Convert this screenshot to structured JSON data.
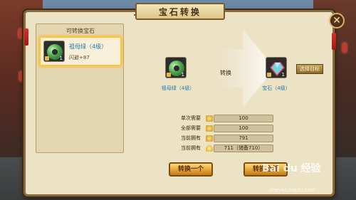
{
  "window": {
    "title": "宝石转换",
    "close_glyph": "✕"
  },
  "left_panel": {
    "header": "可转换宝石",
    "gem": {
      "name": "祖母绿（4级）",
      "stat": "闪避+87",
      "count": "1",
      "icon": "emerald-ring-icon"
    }
  },
  "conversion": {
    "source": {
      "name": "祖母绿（4级）",
      "count": "1",
      "icon": "emerald-ring-icon"
    },
    "target": {
      "name": "宝石（4级）",
      "count": "1",
      "icon": "gem-placeholder-icon"
    },
    "convert_label": "转换",
    "select_target_button": "选择目标"
  },
  "costs": [
    {
      "label": "单次需要",
      "value": "100",
      "icon": "gold-coin-icon"
    },
    {
      "label": "全部需要",
      "value": "100",
      "icon": "gold-coin-icon"
    },
    {
      "label": "当前拥有",
      "value": "791",
      "icon": "gold-coin-icon"
    },
    {
      "label": "当前拥有",
      "value": "711（储备710）",
      "icon": "gold-ingot-icon"
    }
  ],
  "buttons": {
    "convert_one": "转换一个",
    "convert_all": "转换全部"
  },
  "watermark": {
    "brand": "Bai du 经验",
    "url": "jingyan.baidu.com"
  },
  "colors": {
    "panel_bg": "#ece2c4",
    "highlight": "#ffc53a",
    "gem_name": "#1f7aa8",
    "button_gold": "#e7a93a"
  }
}
